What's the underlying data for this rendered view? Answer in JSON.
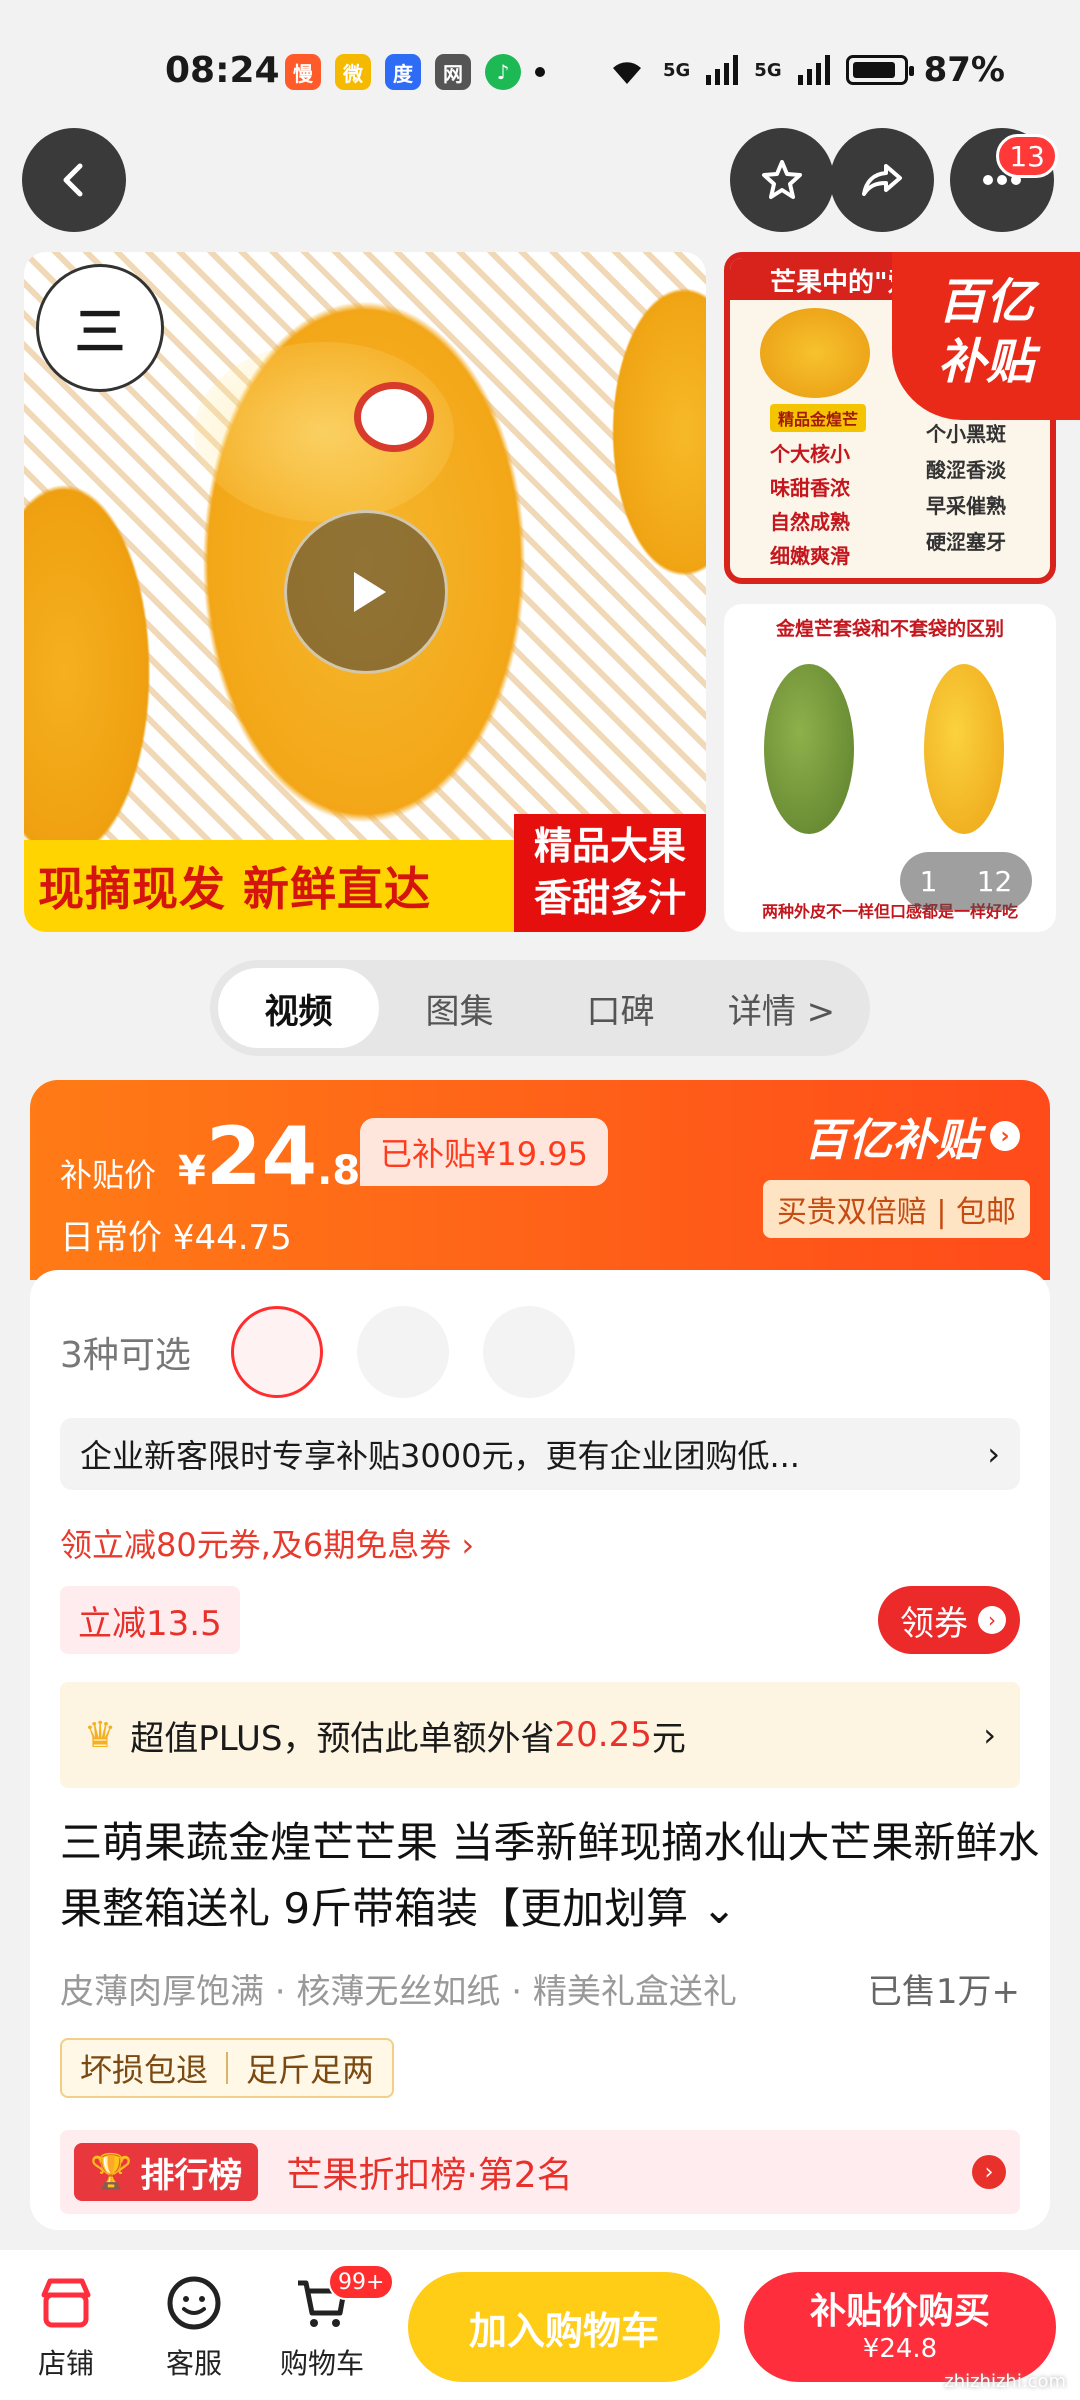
{
  "status_bar": {
    "time": "08:24",
    "battery_percent": "87%",
    "apps": [
      {
        "name": "慢",
        "color": "#ff5a2a"
      },
      {
        "name": "微",
        "color": "#f5b900"
      },
      {
        "name": "度",
        "color": "#2f6cf6"
      },
      {
        "name": "网",
        "color": "#555555"
      },
      {
        "name": "♪",
        "color": "#1db954"
      }
    ],
    "signal": [
      "5G",
      "5G"
    ]
  },
  "top_nav": {
    "back_icon": "chevron-left",
    "favorite_icon": "star",
    "share_icon": "share-arrow",
    "more_icon": "ellipsis",
    "notification_count": "13"
  },
  "gallery": {
    "main_banner_yellow": "现摘现发 新鲜直达",
    "main_banner_red_line1": "精品大果",
    "main_banner_red_line2": "香甜多汁",
    "side1_header": "芒果中的\"爱",
    "subsidy_badge_line1": "百亿",
    "subsidy_badge_line2": "补贴",
    "side1_features_left": [
      "个大核小",
      "味甜香浓",
      "自然成熟",
      "细嫩爽滑"
    ],
    "side1_features_right": [
      "个小黑斑",
      "酸涩香淡",
      "早采催熟",
      "硬涩塞牙"
    ],
    "side1_label": "精品金煌芒",
    "side2_header": "金煌芒套袋和不套袋的区别",
    "side2_footer": "两种外皮不一样但口感都是一样好吃",
    "page_current": "1",
    "page_total": "12"
  },
  "tabs": [
    {
      "label": "视频",
      "active": true
    },
    {
      "label": "图集",
      "active": false
    },
    {
      "label": "口碑",
      "active": false
    },
    {
      "label": "详情 >",
      "active": false
    }
  ],
  "price": {
    "subsidy_label": "补贴价",
    "currency": "¥",
    "price_int": "24",
    "price_dec": ".8",
    "subsidized": "已补贴¥19.95",
    "daily_label": "日常价 ¥44.75",
    "brand": "百亿补贴",
    "guarantee": "买贵双倍赔 | 包邮"
  },
  "variants": {
    "label": "3种可选",
    "count": 3
  },
  "promo": {
    "enterprise": "企业新客限时专享补贴3000元，更有企业团购低...",
    "coupon_link": "领立减80元券,及6期免息券 ›",
    "instant_discount": "立减13.5",
    "get_coupon": "领券",
    "plus_prefix": "超值PLUS，预估此单额外省",
    "plus_amount": "20.25",
    "plus_suffix": "元"
  },
  "product": {
    "title": "三萌果蔬金煌芒芒果 当季新鲜现摘水仙大芒果新鲜水果整箱送礼 9斤带箱装【更加划算",
    "tags": "皮薄肉厚饱满 · 核薄无丝如纸 · 精美礼盒送礼",
    "sold": "已售1万+",
    "badges": [
      "坏损包退",
      "足斤足两"
    ],
    "rank_tag": "排行榜",
    "rank_text": "芒果折扣榜·第2名"
  },
  "bottom_bar": {
    "store": "店铺",
    "service": "客服",
    "cart": "购物车",
    "cart_badge": "99+",
    "add_cart": "加入购物车",
    "buy_line1": "补贴价购买",
    "buy_line2": "¥24.8",
    "watermark": "zhizhizhi.com"
  },
  "colors": {
    "accent_red": "#ff2e3c",
    "accent_orange": "#ff7b16",
    "cart_yellow": "#ffcc16"
  }
}
